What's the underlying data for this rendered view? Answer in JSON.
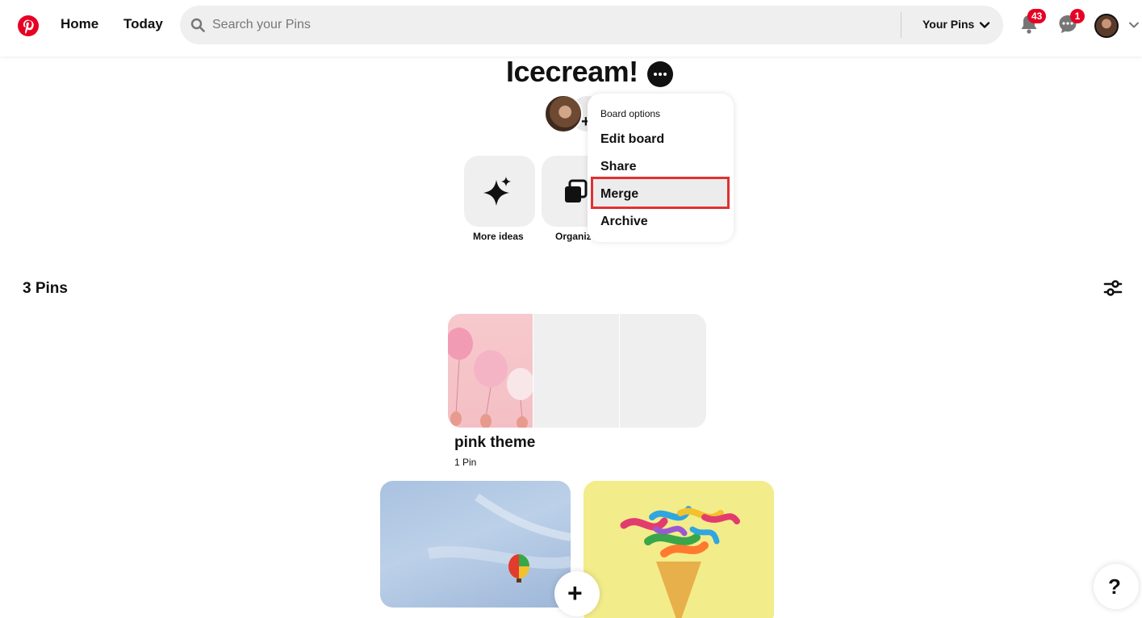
{
  "header": {
    "nav": {
      "home": "Home",
      "today": "Today"
    },
    "search": {
      "placeholder": "Search your Pins",
      "scope": "Your Pins"
    },
    "notifications_badge": "43",
    "messages_badge": "1"
  },
  "board": {
    "title": "Icecream!",
    "tiles": {
      "more_ideas": "More ideas",
      "organize": "Organize"
    }
  },
  "board_menu": {
    "header": "Board options",
    "items": [
      "Edit board",
      "Share",
      "Merge",
      "Archive"
    ]
  },
  "pins": {
    "count_label": "3 Pins"
  },
  "section": {
    "title": "pink theme",
    "meta": "1 Pin"
  },
  "fab": {
    "add": "+",
    "help": "?"
  },
  "colors": {
    "brand": "#e60023",
    "highlight": "#e03131"
  }
}
